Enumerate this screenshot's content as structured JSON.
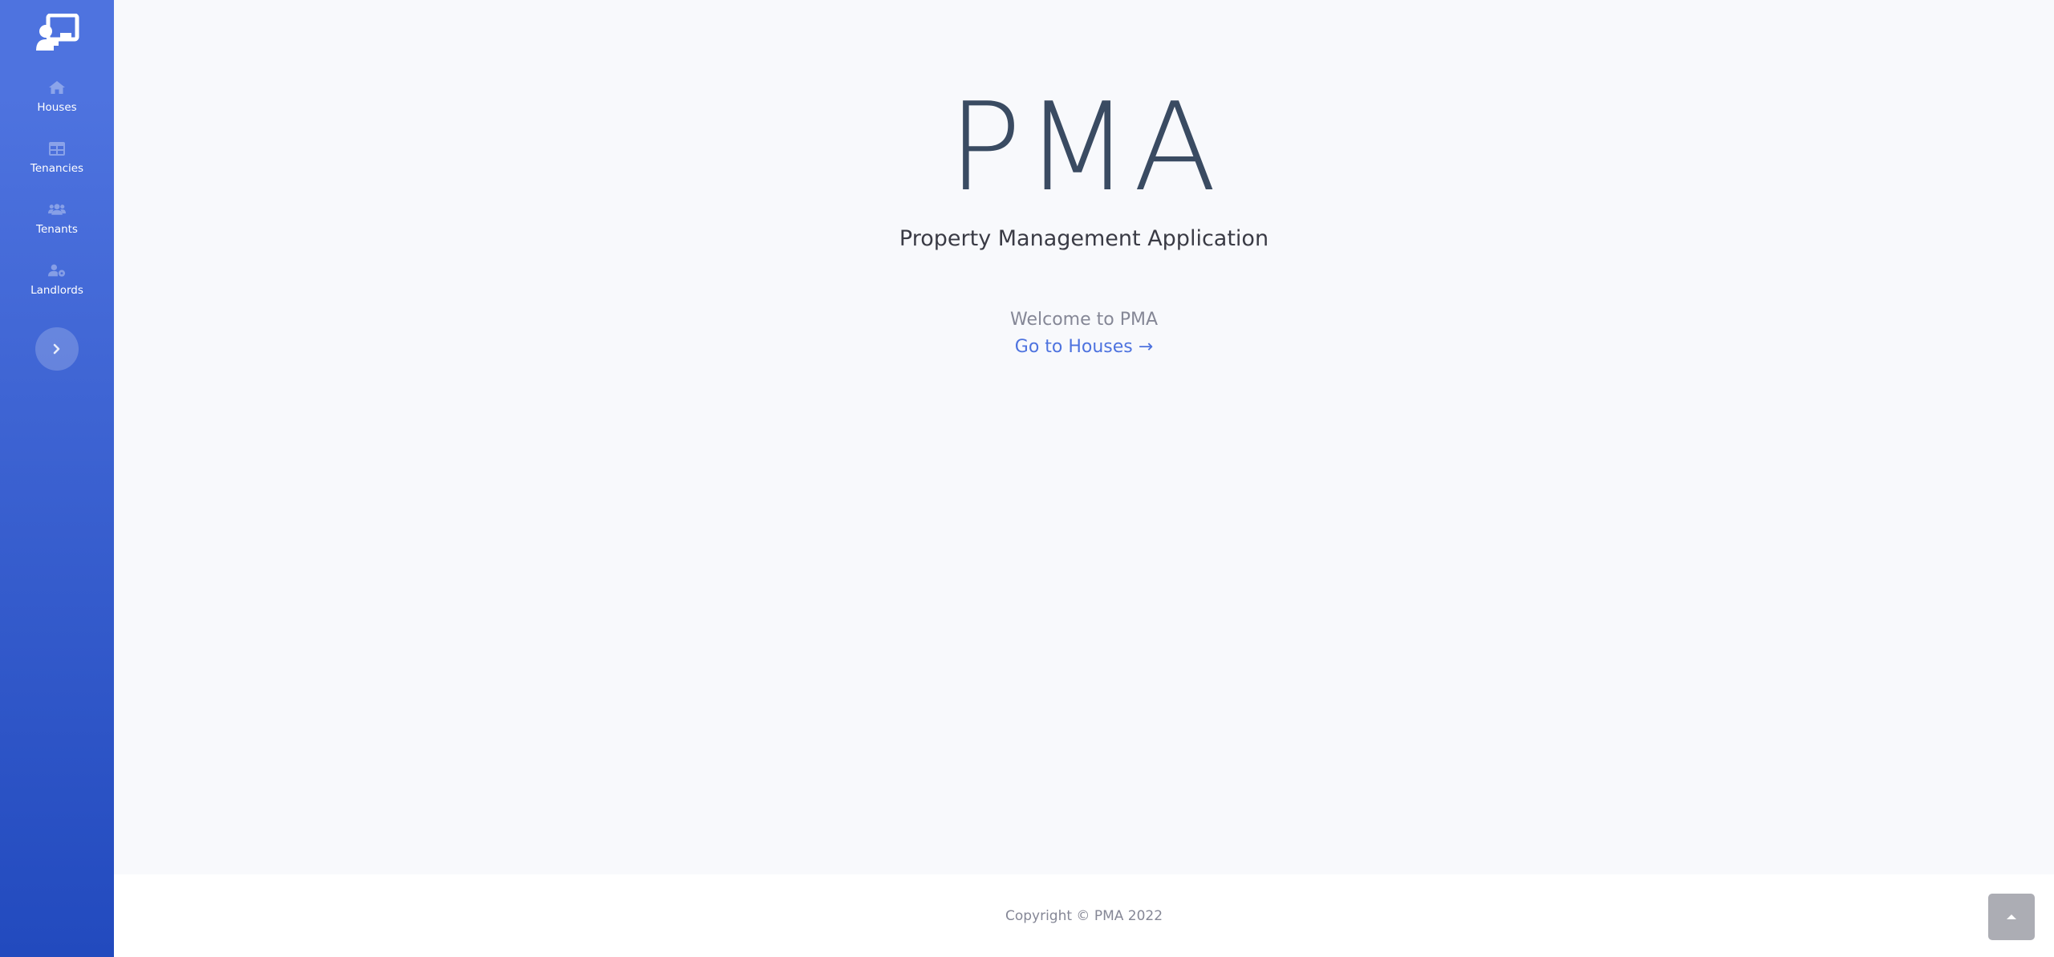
{
  "sidebar": {
    "brand_icon": "chalkboard-teacher-icon",
    "items": [
      {
        "label": "Houses",
        "icon": "home-icon"
      },
      {
        "label": "Tenancies",
        "icon": "table-icon"
      },
      {
        "label": "Tenants",
        "icon": "users-icon"
      },
      {
        "label": "Landlords",
        "icon": "user-cog-icon"
      }
    ],
    "toggle_icon": "chevron-right-icon"
  },
  "main": {
    "title": "PMA",
    "subtitle": "Property Management Application",
    "welcome": "Welcome to PMA",
    "link_label": "Go to Houses →"
  },
  "footer": {
    "copyright": "Copyright © PMA 2022"
  },
  "scroll_top_icon": "chevron-up-icon",
  "colors": {
    "sidebar_top": "#4e73df",
    "sidebar_bottom": "#224abe",
    "accent": "#4e73df",
    "title": "#3a4b62",
    "muted": "#858796",
    "background": "#f8f9fc"
  }
}
